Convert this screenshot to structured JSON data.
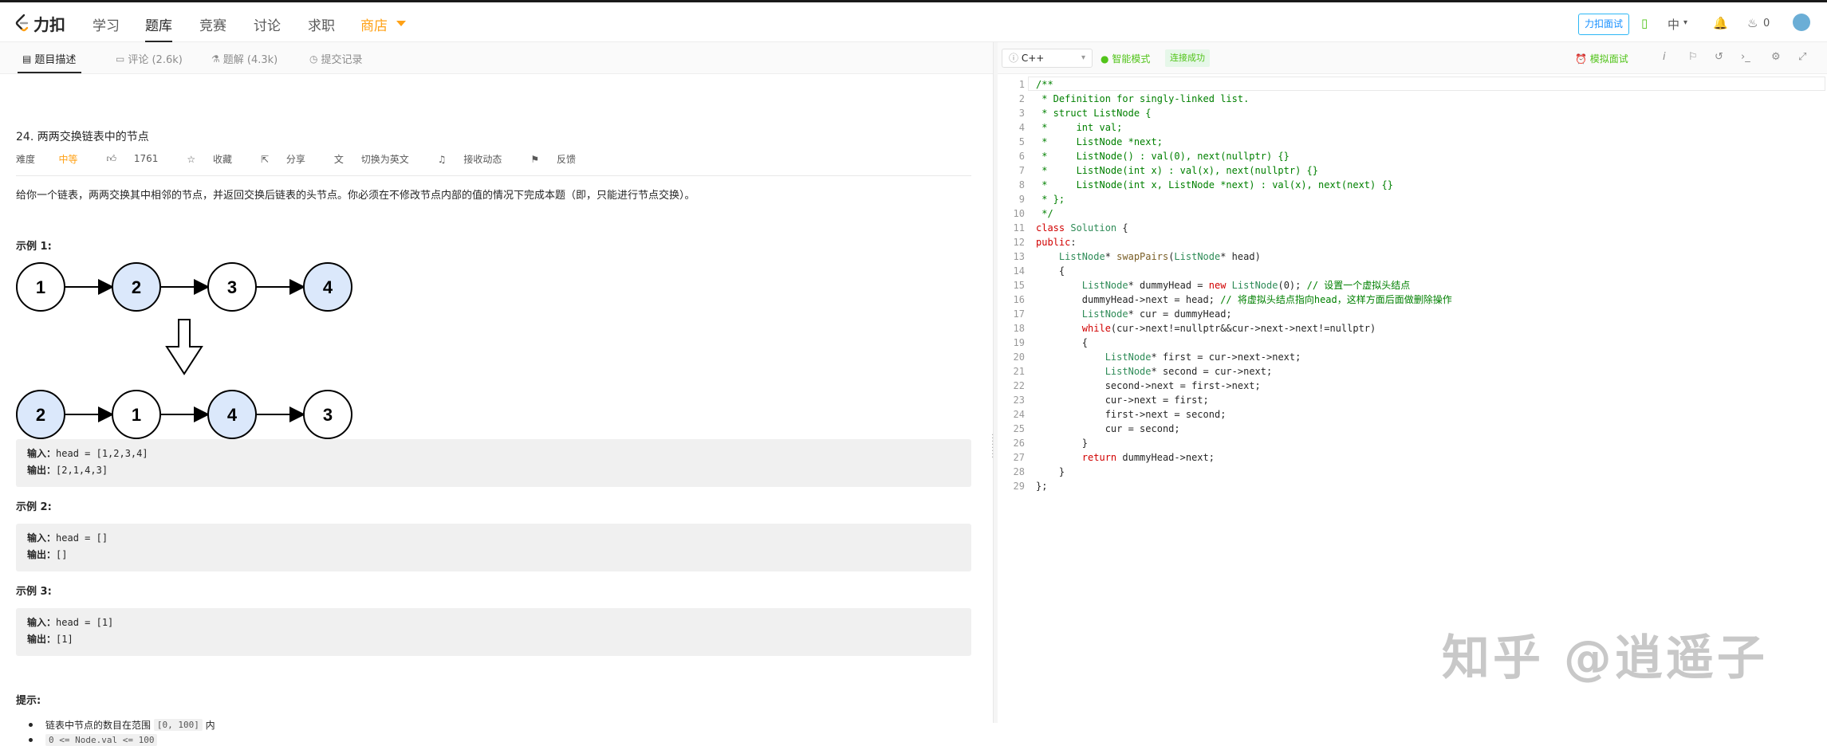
{
  "topnav": {
    "logo_text": "力扣",
    "items": [
      "学习",
      "题库",
      "竞赛",
      "讨论",
      "求职",
      "商店"
    ],
    "interview_label": "力扣面试",
    "lang_label": "中",
    "fire_count": "0"
  },
  "left": {
    "tabs": [
      "题目描述",
      "评论 (2.6k)",
      "题解 (4.3k)",
      "提交记录"
    ],
    "title": "24. 两两交换链表中的节点",
    "meta": {
      "difficulty_label": "难度",
      "difficulty_value": "中等",
      "likes": "1761",
      "favorite": "收藏",
      "share": "分享",
      "switch_en": "切换为英文",
      "subscribe": "接收动态",
      "feedback": "反馈"
    },
    "description": "给你一个链表，两两交换其中相邻的节点，并返回交换后链表的头节点。你必须在不修改节点内部的值的情况下完成本题（即，只能进行节点交换）。",
    "example1": {
      "title": "示例 1:",
      "top_nodes": [
        "1",
        "2",
        "3",
        "4"
      ],
      "bottom_nodes": [
        "2",
        "1",
        "4",
        "3"
      ],
      "input_label": "输入：",
      "input": "head = [1,2,3,4]",
      "output_label": "输出：",
      "output": "[2,1,4,3]"
    },
    "example2": {
      "title": "示例 2:",
      "input_label": "输入：",
      "input": "head = []",
      "output_label": "输出：",
      "output": "[]"
    },
    "example3": {
      "title": "示例 3:",
      "input_label": "输入：",
      "input": "head = [1]",
      "output_label": "输出：",
      "output": "[1]"
    },
    "hints_title": "提示:",
    "hint1_prefix": "链表中节点的数目在范围",
    "hint1_code": "[0, 100]",
    "hint1_suffix": "内",
    "hint2_code": "0 <= Node.val <= 100"
  },
  "editor": {
    "language": "C++",
    "smart_mode": "智能模式",
    "connection": "连接成功",
    "mock_interview": "模拟面试",
    "line_numbers": [
      "1",
      "2",
      "3",
      "4",
      "5",
      "6",
      "7",
      "8",
      "9",
      "10",
      "11",
      "12",
      "13",
      "14",
      "15",
      "16",
      "17",
      "18",
      "19",
      "20",
      "21",
      "22",
      "23",
      "24",
      "25",
      "26",
      "27",
      "28",
      "29"
    ],
    "lines": [
      "/**",
      " * Definition for singly-linked list.",
      " * struct ListNode {",
      " *     int val;",
      " *     ListNode *next;",
      " *     ListNode() : val(0), next(nullptr) {}",
      " *     ListNode(int x) : val(x), next(nullptr) {}",
      " *     ListNode(int x, ListNode *next) : val(x), next(next) {}",
      " * };",
      " */",
      "class Solution {",
      "public:",
      "    ListNode* swapPairs(ListNode* head)",
      "    {",
      "        ListNode* dummyHead = new ListNode(0); // 设置一个虚拟头结点",
      "        dummyHead->next = head; // 将虚拟头结点指向head，这样方面后面做删除操作",
      "        ListNode* cur = dummyHead;",
      "        while(cur->next!=nullptr&&cur->next->next!=nullptr)",
      "        {",
      "            ListNode* first = cur->next->next;",
      "            ListNode* second = cur->next;",
      "            second->next = first->next;",
      "            cur->next = first;",
      "            first->next = second;",
      "            cur = second;",
      "        }",
      "        return dummyHead->next;",
      "    }",
      "};"
    ]
  },
  "watermark": "知乎 @逍遥子",
  "colors": {
    "accent": "#ffa116",
    "node_highlight": "#dbe8fb",
    "success": "#52c41a"
  }
}
